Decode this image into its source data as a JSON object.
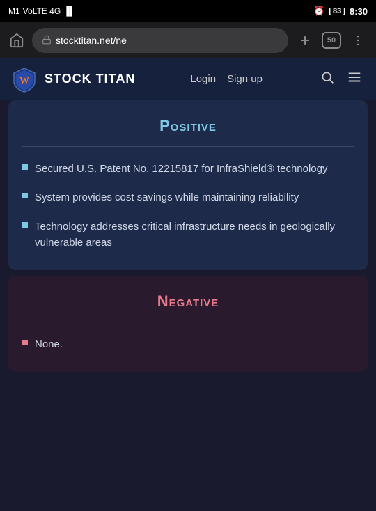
{
  "status_bar": {
    "carrier": "M1",
    "network": "VoLTE 4G",
    "time": "8:30",
    "battery": "83"
  },
  "browser": {
    "address": "stocktitan.net/ne",
    "tab_count": "50",
    "home_label": "home",
    "plus_label": "new tab",
    "menu_label": "menu"
  },
  "header": {
    "logo_text": "STOCK TITAN",
    "nav": {
      "login": "Login",
      "signup": "Sign up"
    }
  },
  "positive_card": {
    "title": "Positive",
    "divider": "",
    "bullets": [
      "Secured U.S. Patent No. 12215817 for InfraShield® technology",
      "System provides cost savings while maintaining reliability",
      "Technology addresses critical infrastructure needs in geologically vulnerable areas"
    ]
  },
  "negative_card": {
    "title": "Negative",
    "divider": "",
    "bullets": [
      "None."
    ]
  }
}
